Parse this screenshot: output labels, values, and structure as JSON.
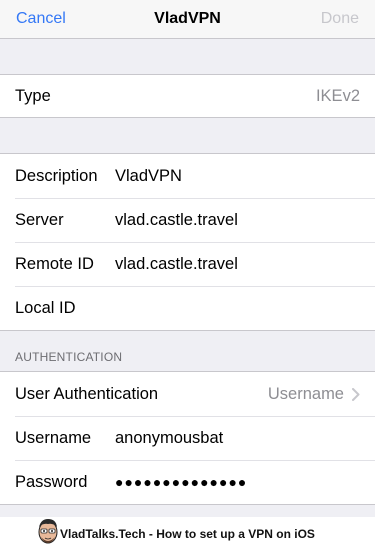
{
  "navbar": {
    "cancel_label": "Cancel",
    "title": "VladVPN",
    "done_label": "Done",
    "accent_color": "#3478f6"
  },
  "type_row": {
    "label": "Type",
    "value": "IKEv2"
  },
  "config": [
    {
      "label": "Description",
      "value": "VladVPN"
    },
    {
      "label": "Server",
      "value": "vlad.castle.travel"
    },
    {
      "label": "Remote ID",
      "value": "vlad.castle.travel"
    },
    {
      "label": "Local ID",
      "value": ""
    }
  ],
  "auth": {
    "header": "AUTHENTICATION",
    "user_auth_label": "User Authentication",
    "user_auth_value": "Username",
    "username_label": "Username",
    "username_value": "anonymousbat",
    "password_label": "Password",
    "password_value": "●●●●●●●●●●●●●●"
  },
  "footer": {
    "text": "VladTalks.Tech - How to set up a VPN on iOS",
    "icon": "avatar-cartoon-icon"
  }
}
